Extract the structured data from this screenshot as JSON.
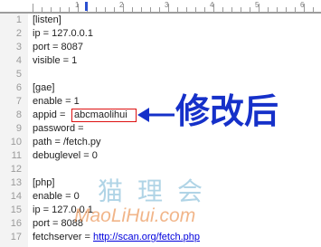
{
  "ruler": {
    "numbers": [
      "1",
      "2",
      "3",
      "4",
      "5",
      "6"
    ]
  },
  "editor": {
    "lines": [
      {
        "num": "1",
        "text": "[listen]"
      },
      {
        "num": "2",
        "text": "ip = 127.0.0.1"
      },
      {
        "num": "3",
        "text": "port = 8087"
      },
      {
        "num": "4",
        "text": "visible = 1"
      },
      {
        "num": "5",
        "text": ""
      },
      {
        "num": "6",
        "text": "[gae]"
      },
      {
        "num": "7",
        "text": "enable = 1"
      },
      {
        "num": "8",
        "text": "appid = "
      },
      {
        "num": "9",
        "text": "password ="
      },
      {
        "num": "10",
        "text": "path = /fetch.py"
      },
      {
        "num": "11",
        "text": "debuglevel = 0"
      },
      {
        "num": "12",
        "text": ""
      },
      {
        "num": "13",
        "text": "[php]"
      },
      {
        "num": "14",
        "text": "enable = 0"
      },
      {
        "num": "15",
        "text": "ip = 127.0.0.1"
      },
      {
        "num": "16",
        "text": "port = 8088"
      },
      {
        "num": "17",
        "text": "fetchserver = "
      }
    ],
    "appid_value": "abcmaolihui",
    "fetchserver_link": "http://scan.org/fetch.php"
  },
  "annotation": {
    "text": "修改后",
    "color": "#1530c9"
  },
  "watermark": {
    "chinese": "猫理会",
    "url": "MaoLiHui.com"
  },
  "colors": {
    "highlight_box": "#dd1111",
    "link": "#0000dd",
    "arrow": "#1530c9"
  }
}
